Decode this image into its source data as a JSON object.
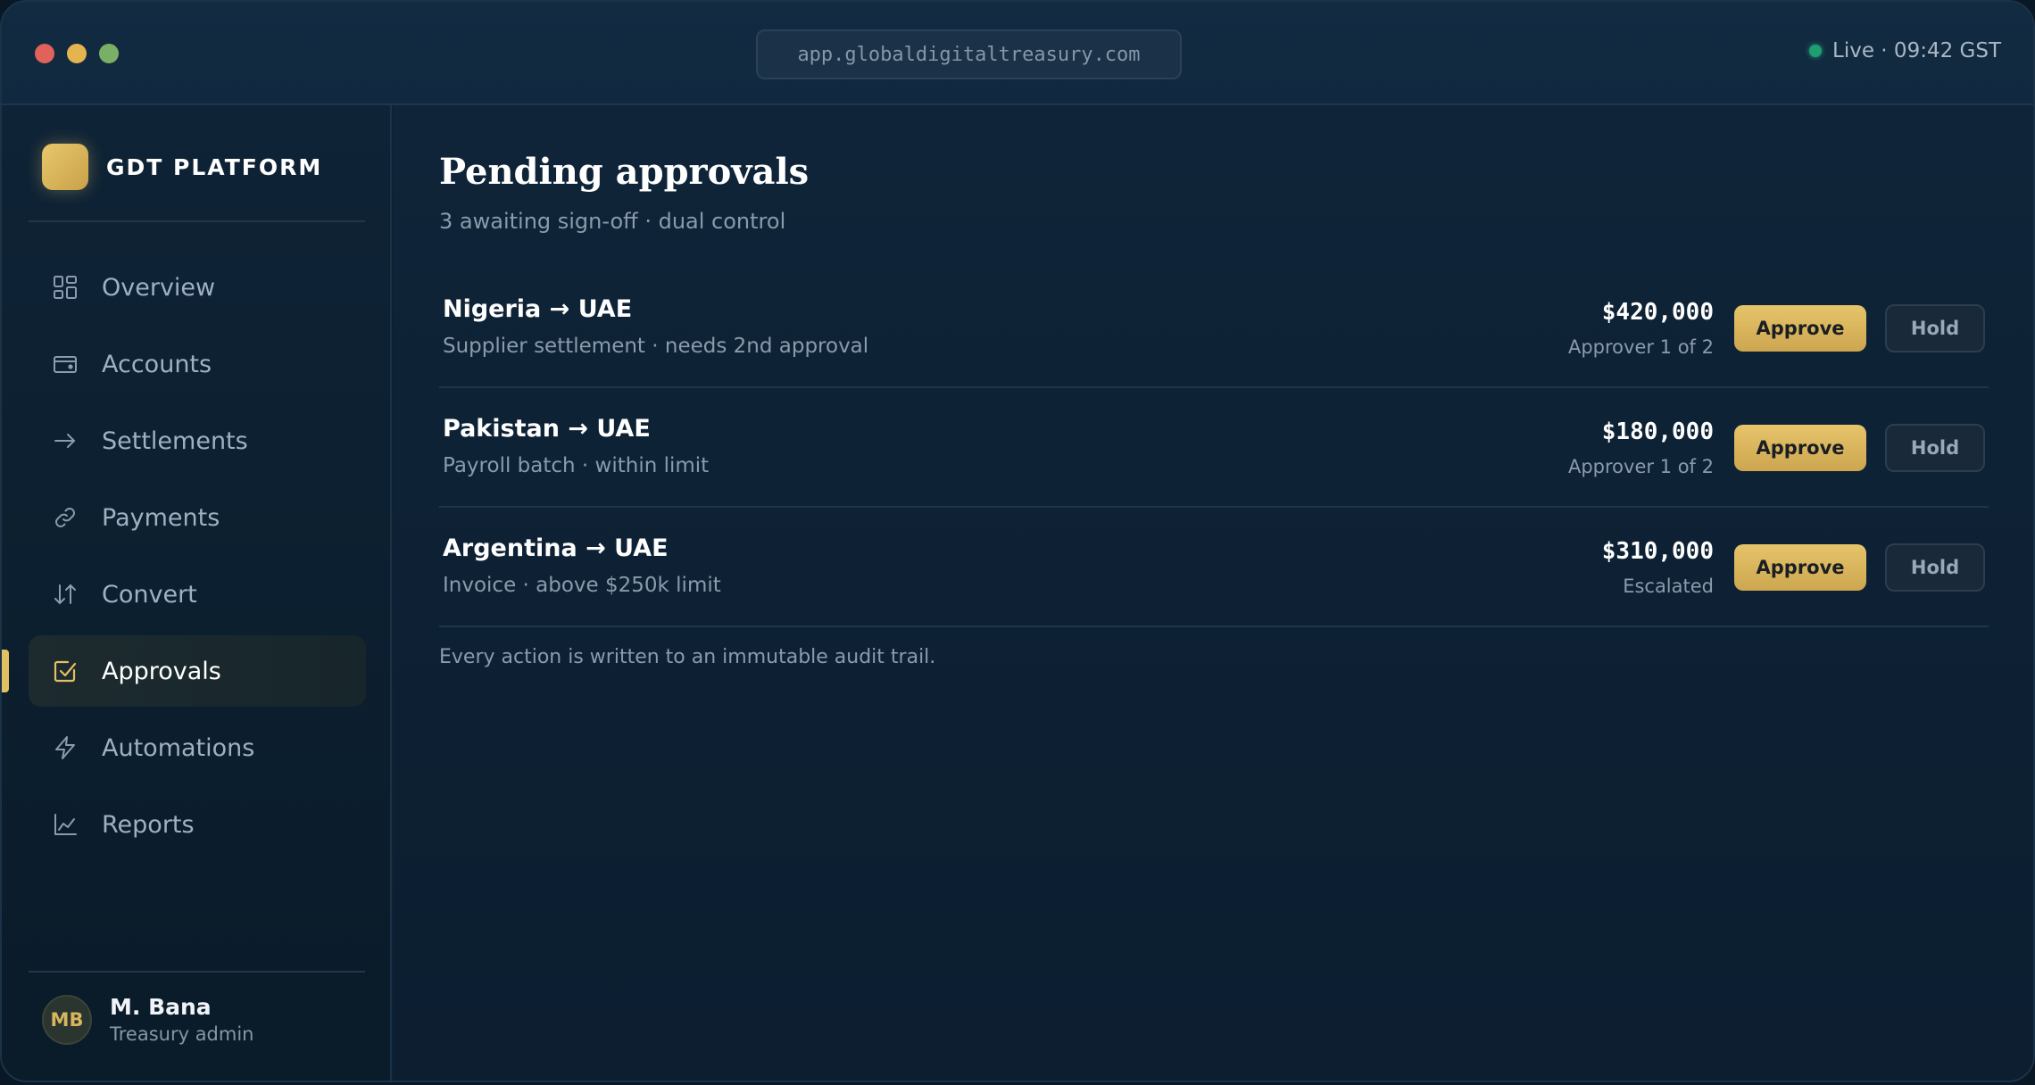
{
  "window": {
    "url": "app.globaldigitaltreasury.com",
    "live_status": "Live · 09:42 GST"
  },
  "sidebar": {
    "brand": "GDT PLATFORM",
    "items": [
      {
        "label": "Overview",
        "icon": "grid-icon",
        "active": false
      },
      {
        "label": "Accounts",
        "icon": "wallet-icon",
        "active": false
      },
      {
        "label": "Settlements",
        "icon": "arrow-right-icon",
        "active": false
      },
      {
        "label": "Payments",
        "icon": "link-icon",
        "active": false
      },
      {
        "label": "Convert",
        "icon": "swap-vertical-icon",
        "active": false
      },
      {
        "label": "Approvals",
        "icon": "checkbox-icon",
        "active": true
      },
      {
        "label": "Automations",
        "icon": "lightning-icon",
        "active": false
      },
      {
        "label": "Reports",
        "icon": "line-chart-icon",
        "active": false
      }
    ],
    "user": {
      "initials": "MB",
      "name": "M. Bana",
      "role": "Treasury admin"
    }
  },
  "main": {
    "title": "Pending approvals",
    "subtitle": "3 awaiting sign-off · dual control",
    "approvals": [
      {
        "route": "Nigeria → UAE",
        "description": "Supplier settlement · needs 2nd approval",
        "amount": "$420,000",
        "status": "Approver 1 of 2",
        "approve_label": "Approve",
        "hold_label": "Hold"
      },
      {
        "route": "Pakistan → UAE",
        "description": "Payroll batch · within limit",
        "amount": "$180,000",
        "status": "Approver 1 of 2",
        "approve_label": "Approve",
        "hold_label": "Hold"
      },
      {
        "route": "Argentina → UAE",
        "description": "Invoice · above $250k limit",
        "amount": "$310,000",
        "status": "Escalated",
        "approve_label": "Approve",
        "hold_label": "Hold"
      }
    ],
    "footnote": "Every action is written to an immutable audit trail."
  },
  "colors": {
    "accent": "#e2bf62",
    "live": "#1f9e72",
    "background": "#0d2135"
  }
}
